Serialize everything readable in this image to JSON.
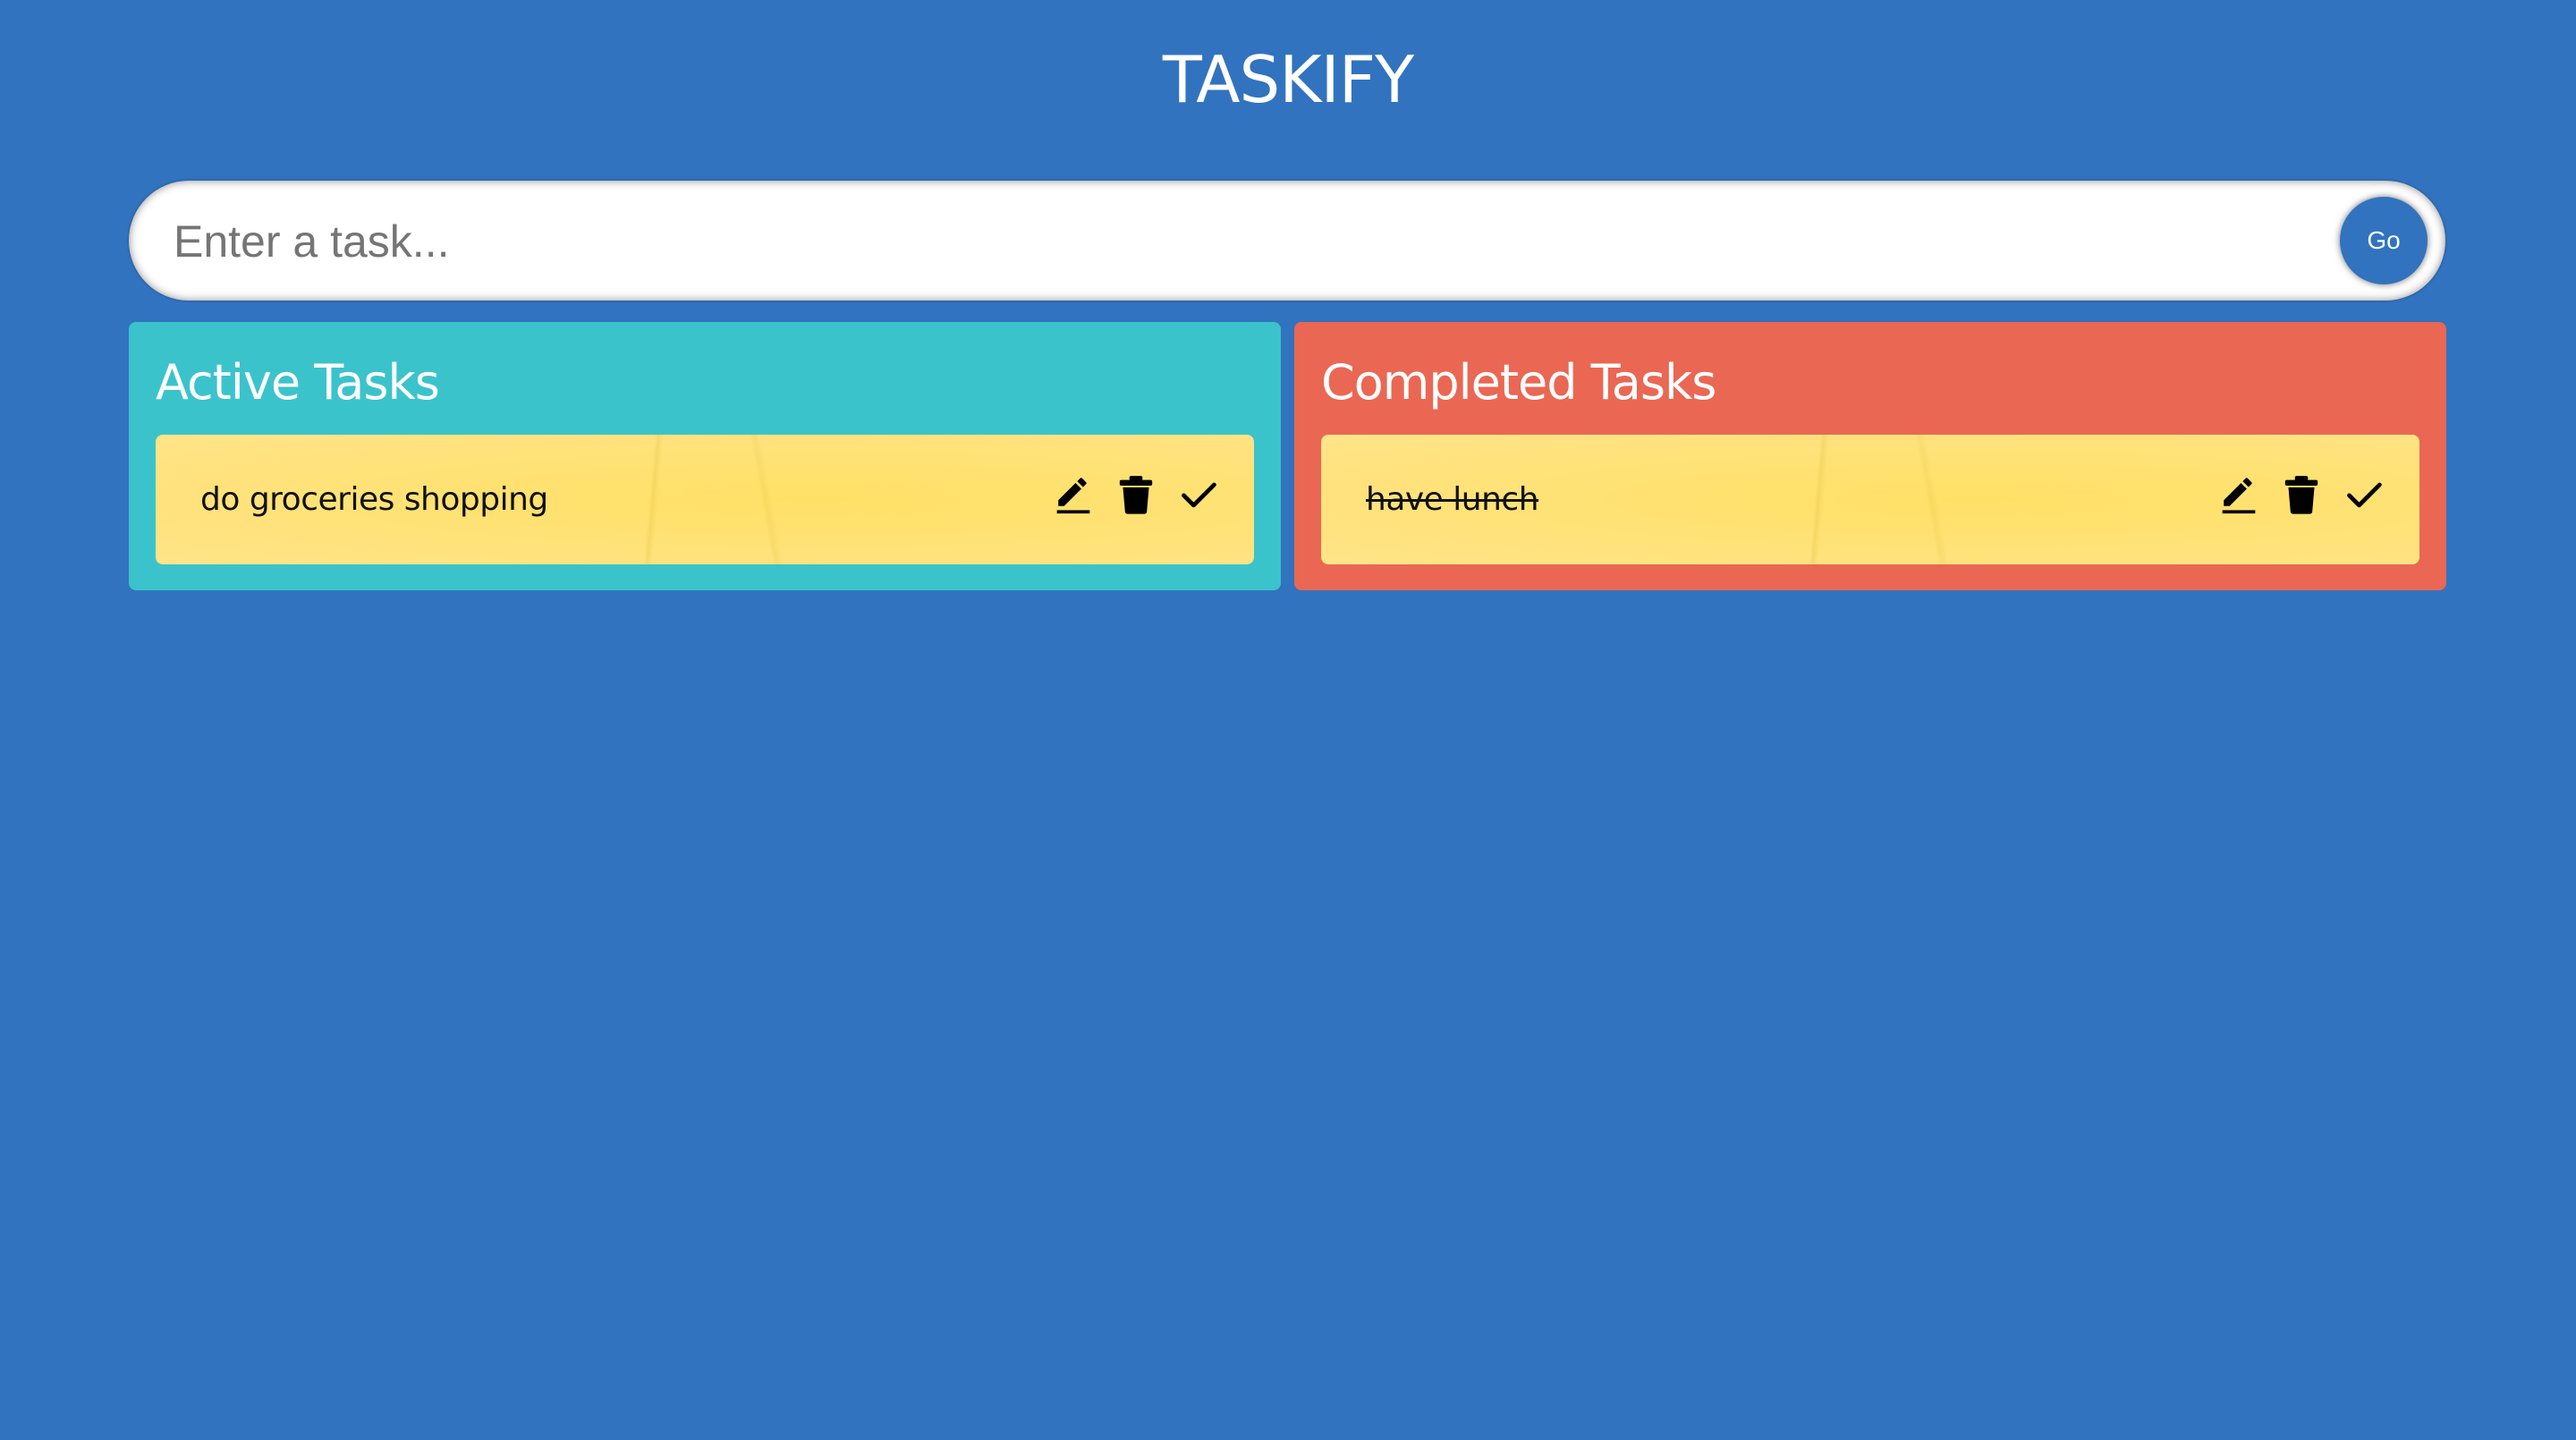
{
  "app": {
    "title": "TASKIFY"
  },
  "task_form": {
    "placeholder": "Enter a task...",
    "value": "",
    "submit_label": "Go"
  },
  "active_panel": {
    "heading": "Active Tasks",
    "tasks": [
      {
        "text": "do groceries shopping",
        "actions": [
          "edit-icon",
          "trash-icon",
          "check-icon"
        ]
      }
    ]
  },
  "completed_panel": {
    "heading": "Completed Tasks",
    "tasks": [
      {
        "text": "have lunch",
        "actions": [
          "edit-icon",
          "trash-icon",
          "check-icon"
        ]
      }
    ]
  },
  "colors": {
    "background": "#3173bf",
    "active_panel": "#3bc3cc",
    "completed_panel": "#ea6753",
    "task_card": "#ffe27a",
    "go_button": "#3173bf"
  }
}
